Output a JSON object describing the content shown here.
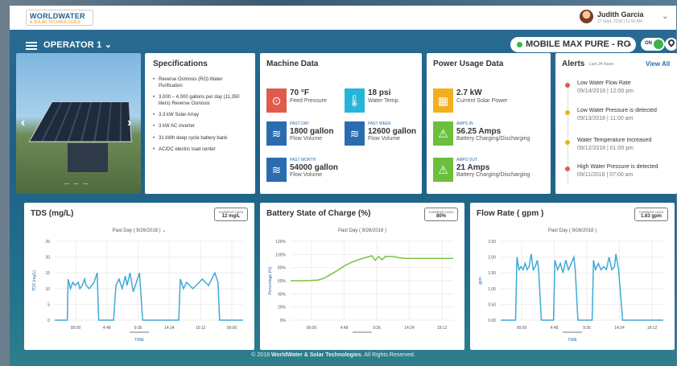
{
  "header": {
    "logo_line1": "WORLDWATER",
    "logo_line2": "& SOLAR TECHNOLOGIES",
    "user_name": "Judith Garcia",
    "user_date": "27 Sept, 2018 | 11:00 AM"
  },
  "operator": {
    "title": "OPERATOR 1 ⌄",
    "device": "MOBILE MAX PURE - RO",
    "device_chev": "⌄",
    "toggle": "ON"
  },
  "specifications": {
    "title": "Specifications",
    "items": [
      "Reverse Osmosis (RO) Water Purification",
      "3,000 – 4,000 gallons per day (11,350 liters) Reverse Osmosis",
      "3.3 kW Solar Array",
      "3 kW AC inverter",
      "31 kWh deep cycle battery bank",
      "AC/DC electric load center"
    ]
  },
  "machine": {
    "title": "Machine Data",
    "feed_pressure": {
      "value": "70 °F",
      "label": "Feed Pressure",
      "color": "#e15b4c"
    },
    "water_temp": {
      "value": "18 psi",
      "label": "Water Temp.",
      "color": "#27b4d9"
    },
    "past_day": {
      "sub": "PAST DAY",
      "value": "1800 gallon",
      "label": "Flow Volume",
      "color": "#2b6cb0"
    },
    "past_week": {
      "sub": "PAST WEEK",
      "value": "12600 gallon",
      "label": "Flow Volume",
      "color": "#2b6cb0"
    },
    "past_month": {
      "sub": "PAST MONTH",
      "value": "54000 gallon",
      "label": "Flow Volume",
      "color": "#2b6cb0"
    }
  },
  "power": {
    "title": "Power Usage Data",
    "solar": {
      "value": "2.7 kW",
      "label": "Current Solar Power",
      "color": "#f2b01e"
    },
    "amps_in": {
      "sub": "AMPS IN",
      "value": "56.25 Amps",
      "label": "Battery Charging/Discharging",
      "color": "#6cbf3d"
    },
    "amps_out": {
      "sub": "AMPS OUT",
      "value": "21 Amps",
      "label": "Battery Charging/Discharging",
      "color": "#6cbf3d"
    }
  },
  "alerts": {
    "title": "Alerts",
    "subtitle": "Last 24 hours",
    "view_all": "View All",
    "items": [
      {
        "text": "Low Water Flow Rate",
        "date": "09/14/2018 | 12:00 pm",
        "color": "#e15b4c"
      },
      {
        "text": "Low Water Pressure is detected",
        "date": "09/13/2018 | 11:00 am",
        "color": "#f2b01e"
      },
      {
        "text": "Water Temperature Increased",
        "date": "09/12/2018 | 01:00 pm",
        "color": "#f2b01e"
      },
      {
        "text": "High Water Pressure is detected",
        "date": "09/11/2018 | 07:00 am",
        "color": "#e15b4c"
      }
    ]
  },
  "charts_text": {
    "tds": {
      "title": "TDS (mg/L)",
      "badge_label": "CURRENT DATA",
      "badge_value": "12 mg/L",
      "period": "Past Day ( 9/26/2018 ) ⌄"
    },
    "battery": {
      "title": "Battery State of Charge (%)",
      "badge_label": "CURRENT DATA",
      "badge_value": "80%",
      "period": "Past Day ( 9/26/2018 )"
    },
    "flow": {
      "title": "Flow Rate ( gpm )",
      "badge_label": "CURRENT DATA",
      "badge_value": "1.83 gpm",
      "period": "Past Day ( 9/26/2018 )"
    }
  },
  "chart_data": [
    {
      "type": "line",
      "ylabel": "TDS (mg/L)",
      "xlabel": "TIME",
      "ylim": [
        0,
        25
      ],
      "yticks": [
        0,
        5,
        10,
        15,
        20,
        25
      ],
      "xticks": [
        "00:00",
        "4:48",
        "9:36",
        "14:24",
        "19:12",
        "00:00"
      ],
      "color": "#3fa9d6",
      "x": [
        0,
        1,
        1.6,
        1.7,
        2,
        2.3,
        2.6,
        3,
        3.2,
        3.5,
        3.8,
        4,
        4.4,
        4.7,
        5,
        5.4,
        5.6,
        5.9,
        6.2,
        6.5,
        6.8,
        7.2,
        7.5,
        7.8,
        8.2,
        8.6,
        9,
        9.2,
        9.6,
        10,
        10.4,
        10.8,
        11.2,
        11.6,
        12,
        12.4,
        12.8,
        13.2,
        13.4,
        13.6,
        14,
        15,
        15.8,
        16,
        16.4,
        16.8,
        17.2,
        17.6,
        18,
        18.4,
        18.8,
        19.2,
        19.6,
        20,
        20.4,
        20.8,
        21,
        21.2,
        22,
        24
      ],
      "y": [
        0,
        0,
        0,
        13,
        10,
        12,
        11,
        12,
        10,
        11,
        13,
        11,
        10,
        11,
        12,
        15,
        0,
        0,
        0,
        0,
        0,
        0,
        0,
        11,
        13,
        10,
        14,
        11,
        15,
        9,
        12,
        15,
        0,
        0,
        0,
        0,
        0,
        0,
        0,
        0,
        0,
        0,
        0,
        13,
        10,
        12,
        11,
        10,
        11,
        12,
        13,
        12,
        11,
        13,
        15,
        12,
        0,
        0,
        0,
        0
      ]
    },
    {
      "type": "line",
      "ylabel": "Percentage (%)",
      "xlabel": "",
      "ylim": [
        0,
        120
      ],
      "yticks": [
        "0%",
        "20%",
        "40%",
        "60%",
        "80%",
        "100%",
        "120%"
      ],
      "xticks": [
        "00:00",
        "4:48",
        "9:36",
        "14:24",
        "19:12"
      ],
      "color": "#7ac143",
      "x": [
        0,
        2,
        4,
        5,
        6,
        7,
        8,
        9,
        10,
        11,
        12,
        12.5,
        13,
        13.5,
        14,
        15,
        16,
        17,
        18,
        19,
        20,
        21,
        22,
        23,
        24
      ],
      "y": [
        60,
        60,
        61,
        64,
        70,
        76,
        83,
        88,
        92,
        95,
        98,
        91,
        97,
        92,
        97,
        97,
        95,
        94,
        94,
        94,
        94,
        94,
        94,
        94,
        94
      ]
    },
    {
      "type": "line",
      "ylabel": "gpm",
      "xlabel": "TIME",
      "ylim": [
        0,
        2.5
      ],
      "yticks": [
        "0.00",
        "0.50",
        "1.00",
        "1.50",
        "2.00",
        "2.50"
      ],
      "xticks": [
        "00:00",
        "4:48",
        "9:36",
        "14:24",
        "19:12"
      ],
      "color": "#3fa9d6",
      "x": [
        0,
        2.2,
        2.4,
        2.7,
        3,
        3.3,
        3.6,
        3.9,
        4.2,
        4.5,
        4.8,
        5.1,
        5.4,
        5.6,
        6,
        7.8,
        8,
        8.4,
        8.8,
        9.2,
        9.6,
        10,
        10.4,
        10.8,
        11,
        11.4,
        13.5,
        13.7,
        14,
        14.4,
        14.8,
        15.2,
        15.6,
        16,
        16.4,
        16.8,
        17,
        17.4,
        18,
        20,
        24
      ],
      "y": [
        0,
        0,
        2.0,
        1.6,
        1.7,
        1.6,
        1.8,
        1.6,
        1.7,
        2.1,
        1.6,
        1.7,
        1.9,
        1.6,
        0,
        0,
        1.9,
        1.6,
        1.8,
        1.5,
        1.9,
        1.6,
        1.8,
        2.0,
        1.6,
        0,
        0,
        1.9,
        1.6,
        1.8,
        1.6,
        1.7,
        1.6,
        2.0,
        1.6,
        1.7,
        2.1,
        1.6,
        0,
        0,
        0
      ]
    }
  ],
  "footer": {
    "prefix": "© 2018 ",
    "brand": "WorldWater & Solar Technologies",
    "suffix": ". All Rights Reserved."
  }
}
